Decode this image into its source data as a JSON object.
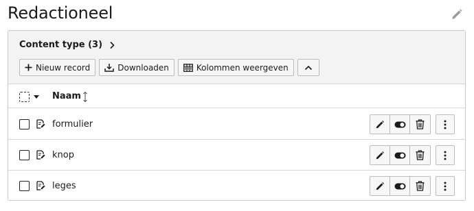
{
  "page": {
    "title": "Redactioneel",
    "edit_icon": "pencil-icon"
  },
  "panel": {
    "heading": "Content type (3)",
    "heading_icon": "chevron-right-icon"
  },
  "toolbar": {
    "new_record": "Nieuw record",
    "new_record_icon": "plus-icon",
    "download": "Downloaden",
    "download_icon": "download-icon",
    "columns": "Kolommen weergeven",
    "columns_icon": "columns-icon",
    "collapse_icon": "chevron-up-icon"
  },
  "table": {
    "column_name": "Naam",
    "sort_icon": "sort-icon",
    "rows": [
      {
        "title": "formulier",
        "icon": "content-type-icon"
      },
      {
        "title": "knop",
        "icon": "content-type-icon"
      },
      {
        "title": "leges",
        "icon": "content-type-icon"
      }
    ],
    "row_actions": [
      "pencil-icon",
      "toggle-icon",
      "trash-icon",
      "more-vertical-icon"
    ]
  },
  "colors": {
    "text": "#1a1a1a",
    "header_bg": "#f3f3f3",
    "border": "#c8c8c8",
    "button_bg": "#f7f7f7",
    "muted_icon": "#9a9a9a"
  }
}
